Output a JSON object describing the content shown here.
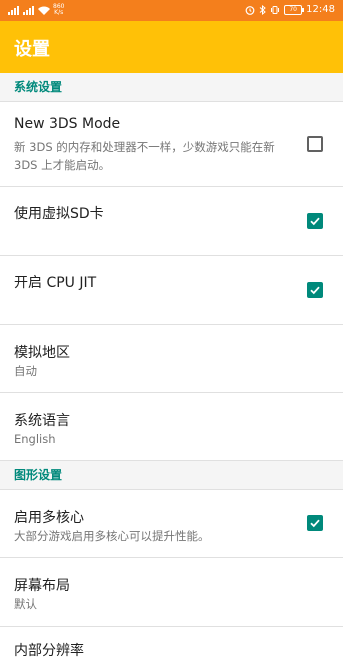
{
  "status_bar": {
    "net_speed": "860\nK/s",
    "time": "12:48",
    "battery": "70",
    "icons": [
      "signal-icon",
      "signal-icon",
      "wifi-icon",
      "alarm-icon",
      "bluetooth-icon",
      "vibrate-icon",
      "battery-icon"
    ]
  },
  "app_bar": {
    "title": "设置"
  },
  "sections": {
    "system": "系统设置",
    "graphics": "图形设置"
  },
  "items": {
    "new3ds": {
      "title": "New 3DS Mode",
      "subtitle": "新 3DS 的内存和处理器不一样，少数游戏只能在新 3DS 上才能启动。",
      "checked": false
    },
    "virtual_sd": {
      "title": "使用虚拟SD卡",
      "checked": true
    },
    "cpu_jit": {
      "title": "开启 CPU JIT",
      "checked": true
    },
    "region": {
      "title": "模拟地区",
      "value": "自动"
    },
    "language": {
      "title": "系统语言",
      "value": "English"
    },
    "multicore": {
      "title": "启用多核心",
      "subtitle": "大部分游戏启用多核心可以提升性能。",
      "checked": true
    },
    "layout": {
      "title": "屏幕布局",
      "value": "默认"
    },
    "resolution": {
      "title": "内部分辨率"
    }
  },
  "colors": {
    "status_bar": "#f47f1c",
    "app_bar": "#ffc107",
    "accent": "#00897b"
  }
}
